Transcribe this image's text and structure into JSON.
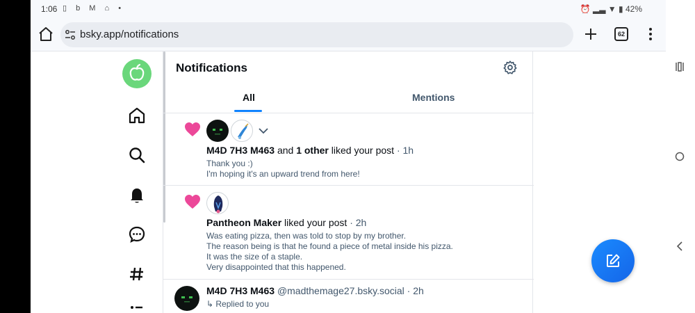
{
  "status_bar": {
    "time": "1:06",
    "battery": "42%"
  },
  "browser": {
    "url": "bsky.app/notifications",
    "tab_count": "62"
  },
  "feed": {
    "title": "Notifications",
    "tabs": [
      {
        "label": "All"
      },
      {
        "label": "Mentions"
      }
    ]
  },
  "notifications": [
    {
      "type": "like",
      "actor": "M4D 7H3 M463",
      "connector": "and",
      "others": "1 other",
      "action": "liked your post",
      "time": "· 1h",
      "post_lines": [
        "Thank you :)",
        "I'm hoping it's an upward trend from here!"
      ]
    },
    {
      "type": "like",
      "actor": "Pantheon Maker",
      "action": "liked your post",
      "time": "· 2h",
      "post_lines": [
        "Was eating pizza, then was told to stop by my brother.",
        "The reason being is that he found a piece of metal inside his pizza.",
        "It was the size of a staple.",
        "Very disappointed that this happened."
      ]
    },
    {
      "type": "reply",
      "actor": "M4D 7H3 M463",
      "handle": "@madthemage27.bsky.social",
      "time": "· 2h",
      "subtitle": "↳ Replied to you"
    }
  ],
  "colors": {
    "accent": "#1083fe",
    "heart": "#ec4899",
    "logo_bg": "#6ad77b"
  }
}
